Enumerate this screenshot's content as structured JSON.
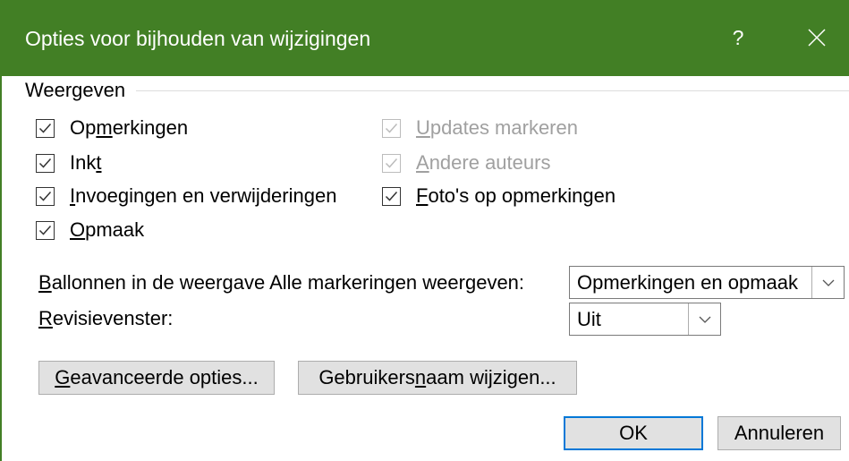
{
  "window": {
    "title": "Opties voor bijhouden van wijzigingen",
    "help_label": "?",
    "close_icon": "close-icon"
  },
  "colors": {
    "title_bar": "#427F25",
    "default_button_border": "#0078D7"
  },
  "display": {
    "group_label": "Weergeven",
    "options": [
      {
        "label": "Opmerkingen",
        "access_key": "m",
        "checked": true,
        "enabled": true
      },
      {
        "label": "Inkt",
        "access_key": "t",
        "checked": true,
        "enabled": true
      },
      {
        "label": "Invoegingen en verwijderingen",
        "access_key": "I",
        "checked": true,
        "enabled": true
      },
      {
        "label": "Opmaak",
        "access_key": "O",
        "checked": true,
        "enabled": true
      },
      {
        "label": "Updates markeren",
        "access_key": "U",
        "checked": true,
        "enabled": false
      },
      {
        "label": "Andere auteurs",
        "access_key": "A",
        "checked": true,
        "enabled": false
      },
      {
        "label": "Foto's op opmerkingen",
        "access_key": "F",
        "checked": true,
        "enabled": true
      }
    ]
  },
  "balloons": {
    "label": "Ballonnen in de weergave Alle markeringen weergeven:",
    "access_key": "B",
    "value": "Opmerkingen en opmaak"
  },
  "reviewing_pane": {
    "label": "Revisievenster:",
    "access_key": "R",
    "value": "Uit"
  },
  "buttons": {
    "advanced": {
      "label": "Geavanceerde opties...",
      "access_key": "G"
    },
    "change_user": {
      "label": "Gebruikersnaam wijzigen...",
      "access_key": "n"
    },
    "ok": {
      "label": "OK"
    },
    "cancel": {
      "label": "Annuleren"
    }
  },
  "icons": {
    "checkbox_mark": "checkmark-icon",
    "dropdown_arrow": "chevron-down-icon"
  }
}
